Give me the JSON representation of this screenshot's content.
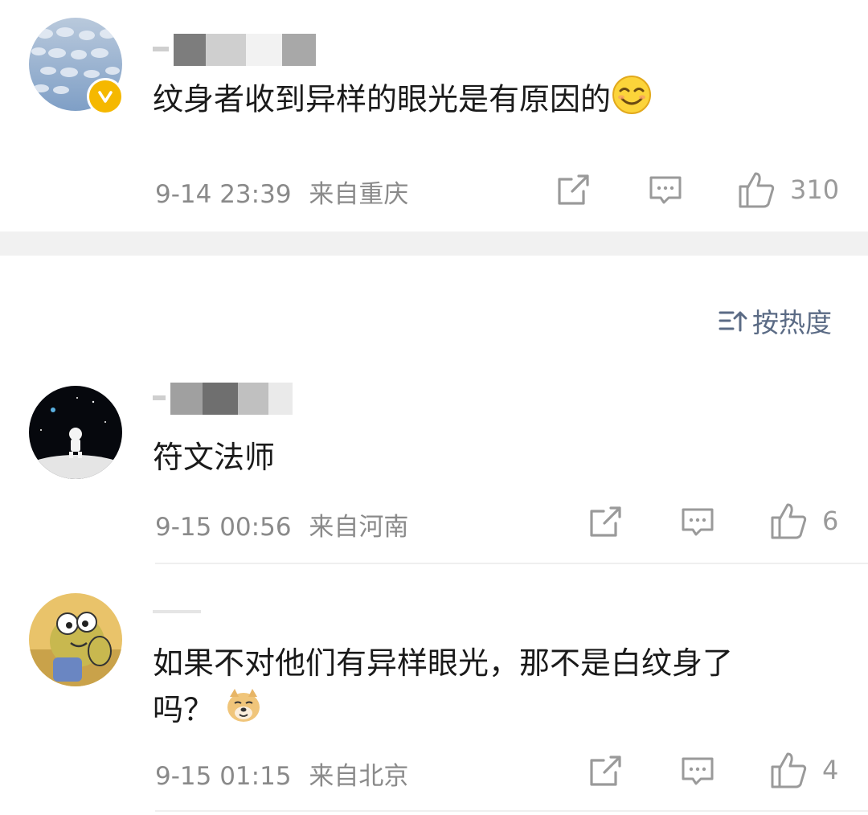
{
  "comments_top": {
    "text": "纹身者收到异样的眼光是有原因的",
    "time": "9-14 23:39",
    "location": "来自重庆",
    "likes": "310"
  },
  "sort": {
    "label": "按热度"
  },
  "comments": [
    {
      "text": "符文法师",
      "time": "9-15 00:56",
      "location": "来自河南",
      "likes": "6"
    },
    {
      "text_line1": "如果不对他们有异样眼光，那不是白纹身了",
      "text_line2": "吗？",
      "time": "9-15 01:15",
      "location": "来自北京",
      "likes": "4"
    }
  ]
}
